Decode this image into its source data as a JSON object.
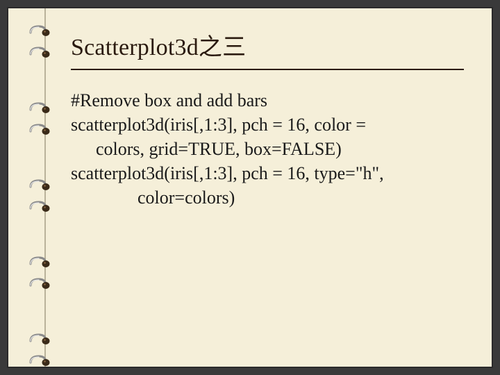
{
  "slide": {
    "title": "Scatterplot3d之三",
    "lines": [
      "#Remove box and add bars",
      "scatterplot3d(iris[,1:3], pch = 16, color =",
      "colors,  grid=TRUE, box=FALSE)",
      "scatterplot3d(iris[,1:3], pch = 16, type=\"h\",",
      "color=colors)"
    ]
  },
  "binding": {
    "ring_positions": [
      24,
      55,
      135,
      166,
      246,
      277,
      357,
      388,
      468,
      499
    ]
  }
}
